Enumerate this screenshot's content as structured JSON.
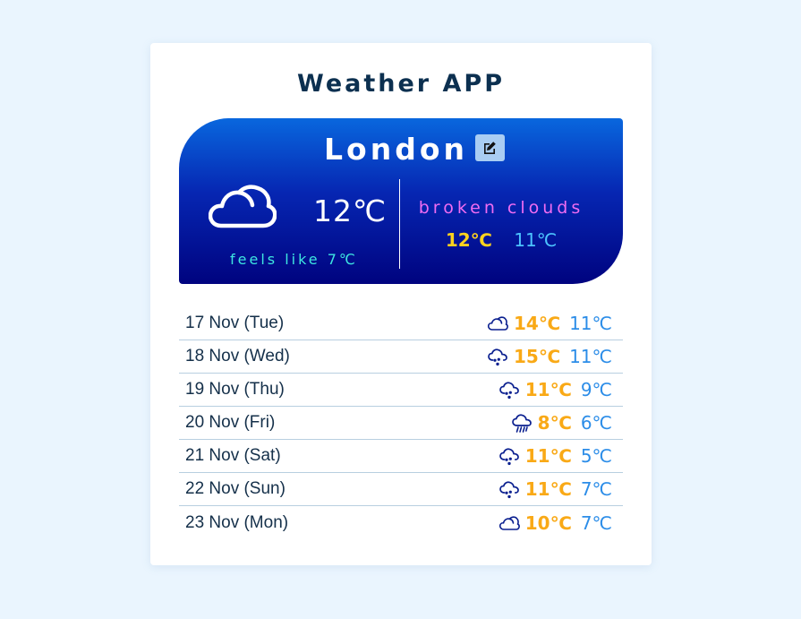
{
  "app": {
    "title": "Weather APP"
  },
  "current": {
    "city": "London",
    "icon": "cloud-icon",
    "temp": "12℃",
    "feels_like": "feels like 7℃",
    "description": "broken clouds",
    "high": "12℃",
    "low": "11℃"
  },
  "forecast": [
    {
      "date": "17 Nov (Tue)",
      "icon": "cloud-icon",
      "high": "14℃",
      "low": "11℃"
    },
    {
      "date": "18 Nov (Wed)",
      "icon": "cloud-rain-icon",
      "high": "15℃",
      "low": "11℃"
    },
    {
      "date": "19 Nov (Thu)",
      "icon": "cloud-rain-icon",
      "high": "11℃",
      "low": "9℃"
    },
    {
      "date": "20 Nov (Fri)",
      "icon": "cloud-showers-icon",
      "high": "8℃",
      "low": "6℃"
    },
    {
      "date": "21 Nov (Sat)",
      "icon": "cloud-rain-icon",
      "high": "11℃",
      "low": "5℃"
    },
    {
      "date": "22 Nov (Sun)",
      "icon": "cloud-rain-icon",
      "high": "11℃",
      "low": "7℃"
    },
    {
      "date": "23 Nov (Mon)",
      "icon": "cloud-icon",
      "high": "10℃",
      "low": "7℃"
    }
  ],
  "colors": {
    "page_bg": "#eaf5fe",
    "title": "#0c3050",
    "description": "#f06cf2",
    "feels_like": "#3ee6e0",
    "current_high": "#ffd21e",
    "current_low": "#4cc3ff",
    "forecast_high": "#f9a916",
    "forecast_low": "#2c8de8",
    "forecast_icon": "#0a1f8f"
  }
}
